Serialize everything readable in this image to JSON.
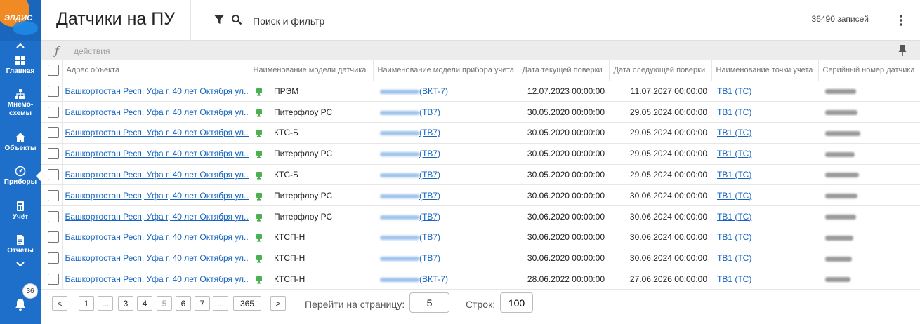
{
  "app": {
    "logo_text": "ЭЛДИС"
  },
  "sidebar": {
    "items": [
      {
        "label": "Главная",
        "icon": "dashboard-icon"
      },
      {
        "label": "Мнемо-\nсхемы",
        "icon": "sitemap-icon"
      },
      {
        "label": "Объекты",
        "icon": "home-icon"
      },
      {
        "label": "Приборы",
        "icon": "gauge-icon",
        "active": true
      },
      {
        "label": "Учёт",
        "icon": "calculator-icon"
      },
      {
        "label": "Отчёты",
        "icon": "document-icon"
      }
    ],
    "notifications_count": "36"
  },
  "header": {
    "title": "Датчики на ПУ",
    "search_placeholder": "Поиск и фильтр",
    "record_count": "36490 записей"
  },
  "toolbar": {
    "fx_symbol": "ƒ",
    "actions_label": "действия"
  },
  "table": {
    "columns": [
      "Адрес объекта",
      "Наименование модели датчика",
      "Наименование модели прибора учета",
      "Дата текущей поверки",
      "Дата следующей поверки",
      "Наименование точки учета",
      "Серийный номер датчика"
    ],
    "rows": [
      {
        "address": "Башкортостан Респ, Уфа г, 40 лет Октября ул...",
        "sensor_model": "ПРЭМ",
        "device_suffix": "(ВКТ-7)",
        "current_check": "12.07.2023 00:00:00",
        "next_check": "11.07.2027 00:00:00",
        "point": "ТВ1 (ТС)"
      },
      {
        "address": "Башкортостан Респ, Уфа г, 40 лет Октября ул...",
        "sensor_model": "Питерфлоу РС",
        "device_suffix": "(ТВ7)",
        "current_check": "30.05.2020 00:00:00",
        "next_check": "29.05.2024 00:00:00",
        "point": "ТВ1 (ТС)"
      },
      {
        "address": "Башкортостан Респ, Уфа г, 40 лет Октября ул...",
        "sensor_model": "КТС-Б",
        "device_suffix": "(ТВ7)",
        "current_check": "30.05.2020 00:00:00",
        "next_check": "29.05.2024 00:00:00",
        "point": "ТВ1 (ТС)"
      },
      {
        "address": "Башкортостан Респ, Уфа г, 40 лет Октября ул...",
        "sensor_model": "Питерфлоу РС",
        "device_suffix": "(ТВ7)",
        "current_check": "30.05.2020 00:00:00",
        "next_check": "29.05.2024 00:00:00",
        "point": "ТВ1 (ТС)"
      },
      {
        "address": "Башкортостан Респ, Уфа г, 40 лет Октября ул...",
        "sensor_model": "КТС-Б",
        "device_suffix": "(ТВ7)",
        "current_check": "30.05.2020 00:00:00",
        "next_check": "29.05.2024 00:00:00",
        "point": "ТВ1 (ТС)"
      },
      {
        "address": "Башкортостан Респ, Уфа г, 40 лет Октября ул...",
        "sensor_model": "Питерфлоу РС",
        "device_suffix": "(ТВ7)",
        "current_check": "30.06.2020 00:00:00",
        "next_check": "30.06.2024 00:00:00",
        "point": "ТВ1 (ТС)"
      },
      {
        "address": "Башкортостан Респ, Уфа г, 40 лет Октября ул...",
        "sensor_model": "Питерфлоу РС",
        "device_suffix": "(ТВ7)",
        "current_check": "30.06.2020 00:00:00",
        "next_check": "30.06.2024 00:00:00",
        "point": "ТВ1 (ТС)"
      },
      {
        "address": "Башкортостан Респ, Уфа г, 40 лет Октября ул...",
        "sensor_model": "КТСП-Н",
        "device_suffix": "(ТВ7)",
        "current_check": "30.06.2020 00:00:00",
        "next_check": "30.06.2024 00:00:00",
        "point": "ТВ1 (ТС)"
      },
      {
        "address": "Башкортостан Респ, Уфа г, 40 лет Октября ул...",
        "sensor_model": "КТСП-Н",
        "device_suffix": "(ТВ7)",
        "current_check": "30.06.2020 00:00:00",
        "next_check": "30.06.2024 00:00:00",
        "point": "ТВ1 (ТС)"
      },
      {
        "address": "Башкортостан Респ, Уфа г, 40 лет Октября ул...",
        "sensor_model": "КТСП-Н",
        "device_suffix": "(ВКТ-7)",
        "current_check": "28.06.2022 00:00:00",
        "next_check": "27.06.2026 00:00:00",
        "point": "ТВ1 (ТС)"
      }
    ]
  },
  "pagination": {
    "prev": "<",
    "next": ">",
    "pages": [
      "1",
      "...",
      "3",
      "4",
      "5",
      "6",
      "7",
      "...",
      "365"
    ],
    "current_page": "5",
    "goto_label": "Перейти на страницу:",
    "goto_value": "5",
    "rows_label": "Строк:",
    "rows_value": "100"
  },
  "colors": {
    "sidebar": "#1e6fc9",
    "link": "#1565c0",
    "device_icon": "#4caf50",
    "toolbar": "#ececec"
  }
}
